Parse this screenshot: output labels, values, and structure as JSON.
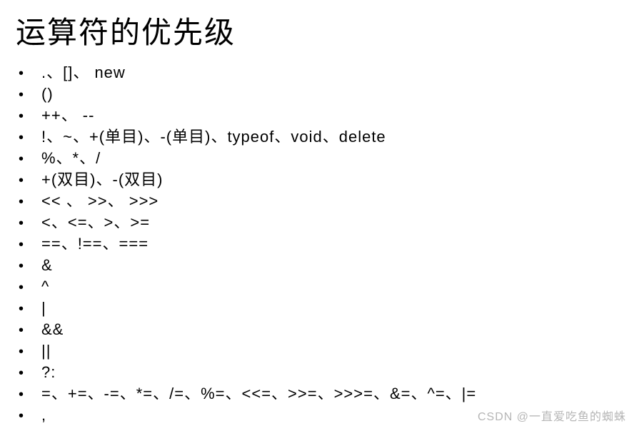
{
  "title": "运算符的优先级",
  "items": [
    ".、[]、 new",
    "()",
    "++、 --",
    "!、~、+(单目)、-(单目)、typeof、void、delete",
    "%、*、/",
    "+(双目)、-(双目)",
    "<< 、 >>、 >>>",
    "<、<=、>、>=",
    "==、!==、===",
    "&",
    "^",
    "|",
    "&&",
    "||",
    "?:",
    "=、+=、-=、*=、/=、%=、<<=、>>=、>>>=、&=、^=、|=",
    ","
  ],
  "watermark": "CSDN @一直爱吃鱼的蜘蛛"
}
